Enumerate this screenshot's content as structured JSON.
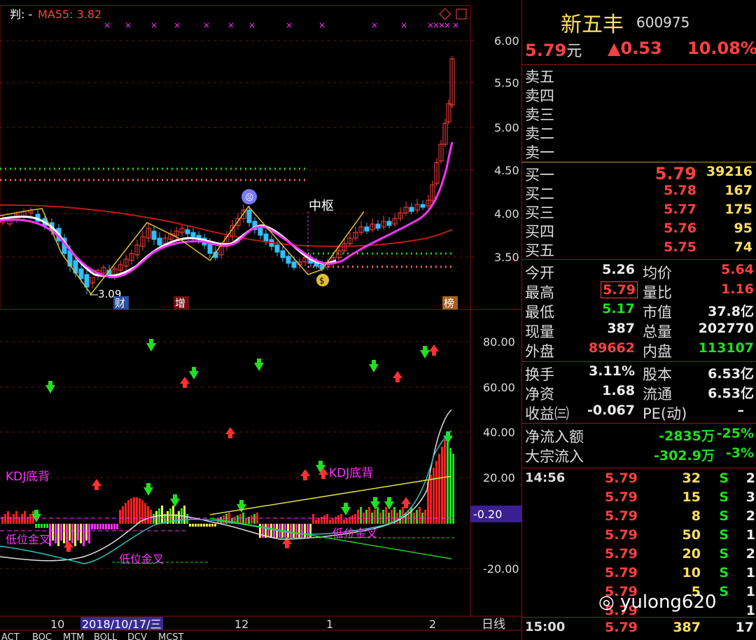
{
  "chart": {
    "indicator_label": "判: -",
    "ma_label": "MA55: 3.82",
    "price_axis": [
      "6.00",
      "5.50",
      "5.00",
      "4.50",
      "4.00",
      "3.50"
    ],
    "osc_axis": [
      "80.00",
      "60.00",
      "40.00",
      "20.00",
      "-20.00"
    ],
    "current_osc_value": "-0.20",
    "low_mark": "3.09",
    "pivot_label": "中枢",
    "events": {
      "cai": "财",
      "zeng": "增",
      "bang": "榜"
    },
    "kdj_label_left": "KDJ底背",
    "kdj_label_right": "KDJ底背",
    "golden_cross_1": "低位金叉",
    "golden_cross_2": "低位金叉",
    "golden_cross_3": "低位金叉",
    "x_axis": {
      "m10": "10",
      "date": "2018/10/17/三",
      "m12": "12",
      "m1": "1",
      "m2": "2"
    },
    "period": "日线",
    "tabs": [
      "ACT",
      "BOC",
      "MTM",
      "BOLL",
      "DCV",
      "MCST"
    ]
  },
  "quote": {
    "name": "新五丰",
    "code": "600975",
    "price": "5.79",
    "unit": "元",
    "change": "▲0.53",
    "change_pct": "10.08%",
    "sell": [
      {
        "label": "卖五"
      },
      {
        "label": "卖四"
      },
      {
        "label": "卖三"
      },
      {
        "label": "卖二"
      },
      {
        "label": "卖一"
      }
    ],
    "buy": [
      {
        "label": "买一",
        "price": "5.79",
        "vol": "39216"
      },
      {
        "label": "买二",
        "price": "5.78",
        "vol": "167"
      },
      {
        "label": "买三",
        "price": "5.77",
        "vol": "175"
      },
      {
        "label": "买四",
        "price": "5.76",
        "vol": "95"
      },
      {
        "label": "买五",
        "price": "5.75",
        "vol": "74"
      }
    ],
    "stats": {
      "open_l": "今开",
      "open": "5.26",
      "avg_l": "均价",
      "avg": "5.64",
      "high_l": "最高",
      "high": "5.79",
      "vr_l": "量比",
      "vr": "1.16",
      "low_l": "最低",
      "low": "5.17",
      "mcap_l": "市值",
      "mcap": "37.8亿",
      "vol_l": "现量",
      "vol": "387",
      "tvol_l": "总量",
      "tvol": "202770",
      "out_l": "外盘",
      "out": "89662",
      "in_l": "内盘",
      "in": "113107"
    },
    "fund": {
      "turn_l": "换手",
      "turn": "3.11%",
      "cap_l": "股本",
      "cap": "6.53亿",
      "na_l": "净资",
      "na": "1.68",
      "float_l": "流通",
      "float": "6.53亿",
      "eps_l": "收益㈢",
      "eps": "-0.067",
      "pe_l": "PE(动)",
      "pe": "–"
    },
    "flow": {
      "net_l": "净流入额",
      "net": "-2835万",
      "net_pct": "-25%",
      "block_l": "大宗流入",
      "block": "-302.9万",
      "block_pct": "-3%"
    },
    "ticks": [
      {
        "time": "14:56",
        "price": "5.79",
        "vol": "32",
        "side": "S",
        "n": "2"
      },
      {
        "time": "",
        "price": "5.79",
        "vol": "15",
        "side": "S",
        "n": "3"
      },
      {
        "time": "",
        "price": "5.79",
        "vol": "8",
        "side": "S",
        "n": "2"
      },
      {
        "time": "",
        "price": "5.79",
        "vol": "50",
        "side": "S",
        "n": "1"
      },
      {
        "time": "",
        "price": "5.79",
        "vol": "20",
        "side": "S",
        "n": "2"
      },
      {
        "time": "",
        "price": "5.79",
        "vol": "10",
        "side": "S",
        "n": "1"
      },
      {
        "time": "",
        "price": "5.79",
        "vol": "5",
        "side": "S",
        "n": "1"
      },
      {
        "time": "",
        "price": "5.79",
        "vol": "",
        "side": "",
        "n": "1"
      }
    ],
    "last_tick": {
      "time": "15:00",
      "price": "5.79",
      "vol": "387",
      "n": "17"
    }
  },
  "watermark": "yulong620",
  "colors": {
    "up": "#ff4040",
    "down": "#20e020",
    "grid": "#8a1010",
    "ma_white": "#ffffff",
    "ma_magenta": "#ff30ff",
    "ma_red": "#c01818"
  }
}
